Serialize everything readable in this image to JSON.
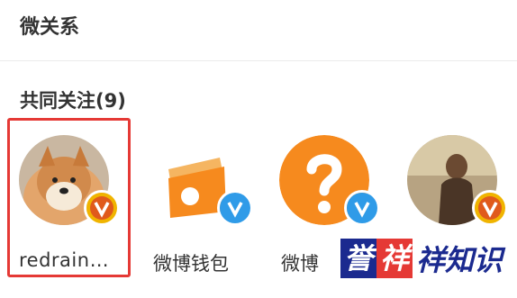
{
  "section": {
    "title": "微关系"
  },
  "follow": {
    "title": "共同关注(9)",
    "users": [
      {
        "name": "redrain…",
        "badge": "orange-v-badge-icon"
      },
      {
        "name": "微博钱包",
        "badge": "blue-v-badge-icon"
      },
      {
        "name": "微博",
        "badge": "blue-v-badge-icon"
      },
      {
        "name": "",
        "badge": "orange-v-badge-icon"
      }
    ]
  },
  "watermark": {
    "char1": "誉",
    "char2": "祥",
    "rest": "祥知识"
  },
  "colors": {
    "highlight": "#e53935",
    "blue_v": "#2f9be8",
    "orange_v": "#f0b400",
    "orange_logo": "#f68a1e"
  }
}
